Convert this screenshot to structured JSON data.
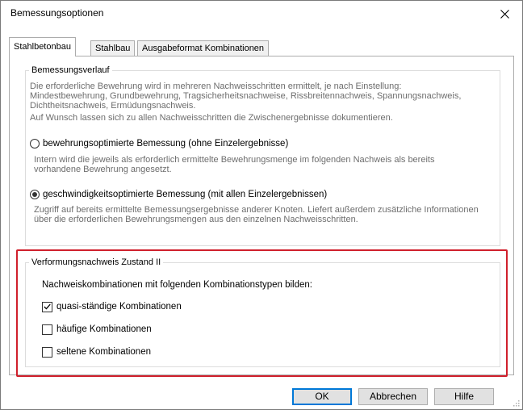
{
  "dialog": {
    "title": "Bemessungsoptionen"
  },
  "tabs": [
    {
      "label": "Stahlbetonbau"
    },
    {
      "label": "Stahlbau"
    },
    {
      "label": "Ausgabeformat Kombinationen"
    }
  ],
  "bemessungsverlauf": {
    "legend": "Bemessungsverlauf",
    "desc_line1": "Die erforderliche Bewehrung wird in mehreren Nachweisschritten ermittelt, je nach Einstellung:",
    "desc_line2": "Mindestbewehrung, Grundbewehrung, Tragsicherheitsnachweise, Rissbreitennachweis, Spannungsnachweis,",
    "desc_line3": "Dichtheitsnachweis, Ermüdungsnachweis.",
    "desc_line4": "Auf Wunsch lassen sich zu allen Nachweisschritten die Zwischenergebnisse dokumentieren.",
    "option1": {
      "label": "bewehrungsoptimierte Bemessung (ohne Einzelergebnisse)",
      "selected": false,
      "desc_line1": "Intern wird die jeweils als erforderlich ermittelte Bewehrungsmenge im folgenden Nachweis als bereits",
      "desc_line2": "vorhandene Bewehrung angesetzt."
    },
    "option2": {
      "label": "geschwindigkeitsoptimierte Bemessung (mit allen Einzelergebnissen)",
      "selected": true,
      "desc_line1": "Zugriff auf bereits ermittelte Bemessungsergebnisse anderer Knoten. Liefert außerdem zusätzliche Informationen",
      "desc_line2": "über die erforderlichen Bewehrungsmengen aus den einzelnen Nachweisschritten."
    }
  },
  "verformung": {
    "legend": "Verformungsnachweis Zustand II",
    "intro": "Nachweiskombinationen mit folgenden Kombinationstypen bilden:",
    "checks": [
      {
        "label": "quasi-ständige Kombinationen",
        "checked": true
      },
      {
        "label": "häufige Kombinationen",
        "checked": false
      },
      {
        "label": "seltene Kombinationen",
        "checked": false
      }
    ]
  },
  "buttons": {
    "ok": "OK",
    "cancel": "Abbrechen",
    "help": "Hilfe"
  },
  "colors": {
    "highlight": "#d0202c",
    "default_button_border": "#0078d7"
  }
}
